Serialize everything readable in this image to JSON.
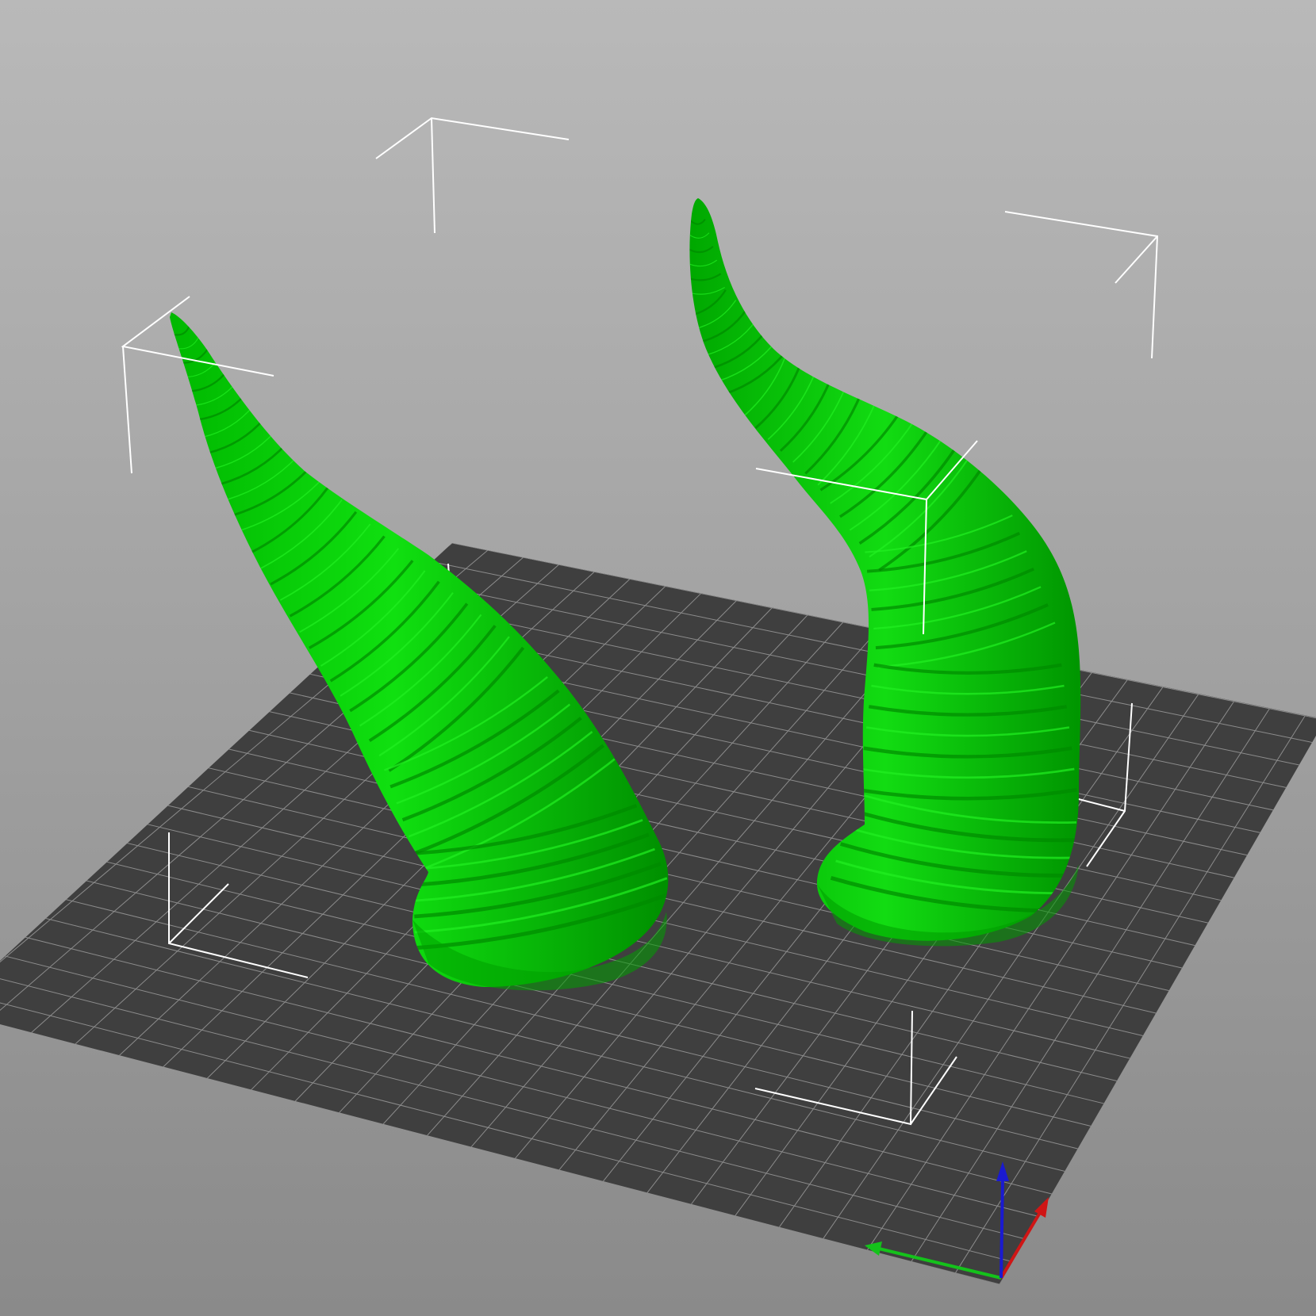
{
  "viewport": {
    "background_top": "#b9b9b9",
    "background_bottom": "#8a8a8a"
  },
  "bed": {
    "fill": "#3f3f3f",
    "grid_line": "#8c8c8c",
    "grid_divisions": 25
  },
  "objects": [
    {
      "name": "horn-left",
      "color": "#00d400",
      "selected": true
    },
    {
      "name": "horn-right",
      "color": "#00d400",
      "selected": true
    }
  ],
  "bounding_box": {
    "color": "#ffffff"
  },
  "axes_gizmo": {
    "x_color": "#d01515",
    "y_color": "#14c21b",
    "z_color": "#1a1ad0"
  }
}
